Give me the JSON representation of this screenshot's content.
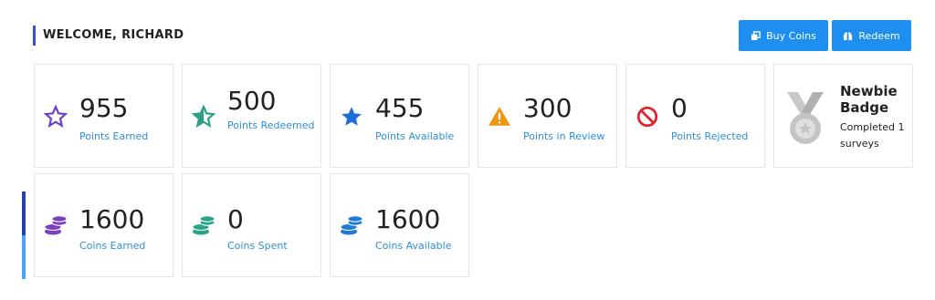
{
  "header": {
    "welcome": "WELCOME, RICHARD",
    "buy_coins_label": "Buy Coins",
    "redeem_label": "Redeem"
  },
  "points": [
    {
      "value": "955",
      "label": "Points Earned",
      "icon": "star-outline-icon",
      "color": "#6a3fc0"
    },
    {
      "value": "500",
      "label": "Points Redeemed",
      "icon": "star-half-icon",
      "color": "#27a085"
    },
    {
      "value": "455",
      "label": "Points Available",
      "icon": "star-filled-icon",
      "color": "#1e6ed8"
    },
    {
      "value": "300",
      "label": "Points in Review",
      "icon": "warning-icon",
      "color": "#f0960e"
    },
    {
      "value": "0",
      "label": "Points Rejected",
      "icon": "blocked-icon",
      "color": "#e0232e"
    }
  ],
  "badge": {
    "title": "Newbie Badge",
    "subtitle": "Completed 1 surveys",
    "icon": "medal-icon"
  },
  "coins": [
    {
      "value": "1600",
      "label": "Coins Earned",
      "icon": "coin-stack-icon",
      "color": "#7b3fc0"
    },
    {
      "value": "0",
      "label": "Coins Spent",
      "icon": "coin-stack-icon",
      "color": "#2aa58a"
    },
    {
      "value": "1600",
      "label": "Coins Available",
      "icon": "coin-stack-icon",
      "color": "#1e7ad8"
    }
  ],
  "colors": {
    "accent": "#1e8ef0",
    "label_blue": "#2b8fe0"
  }
}
